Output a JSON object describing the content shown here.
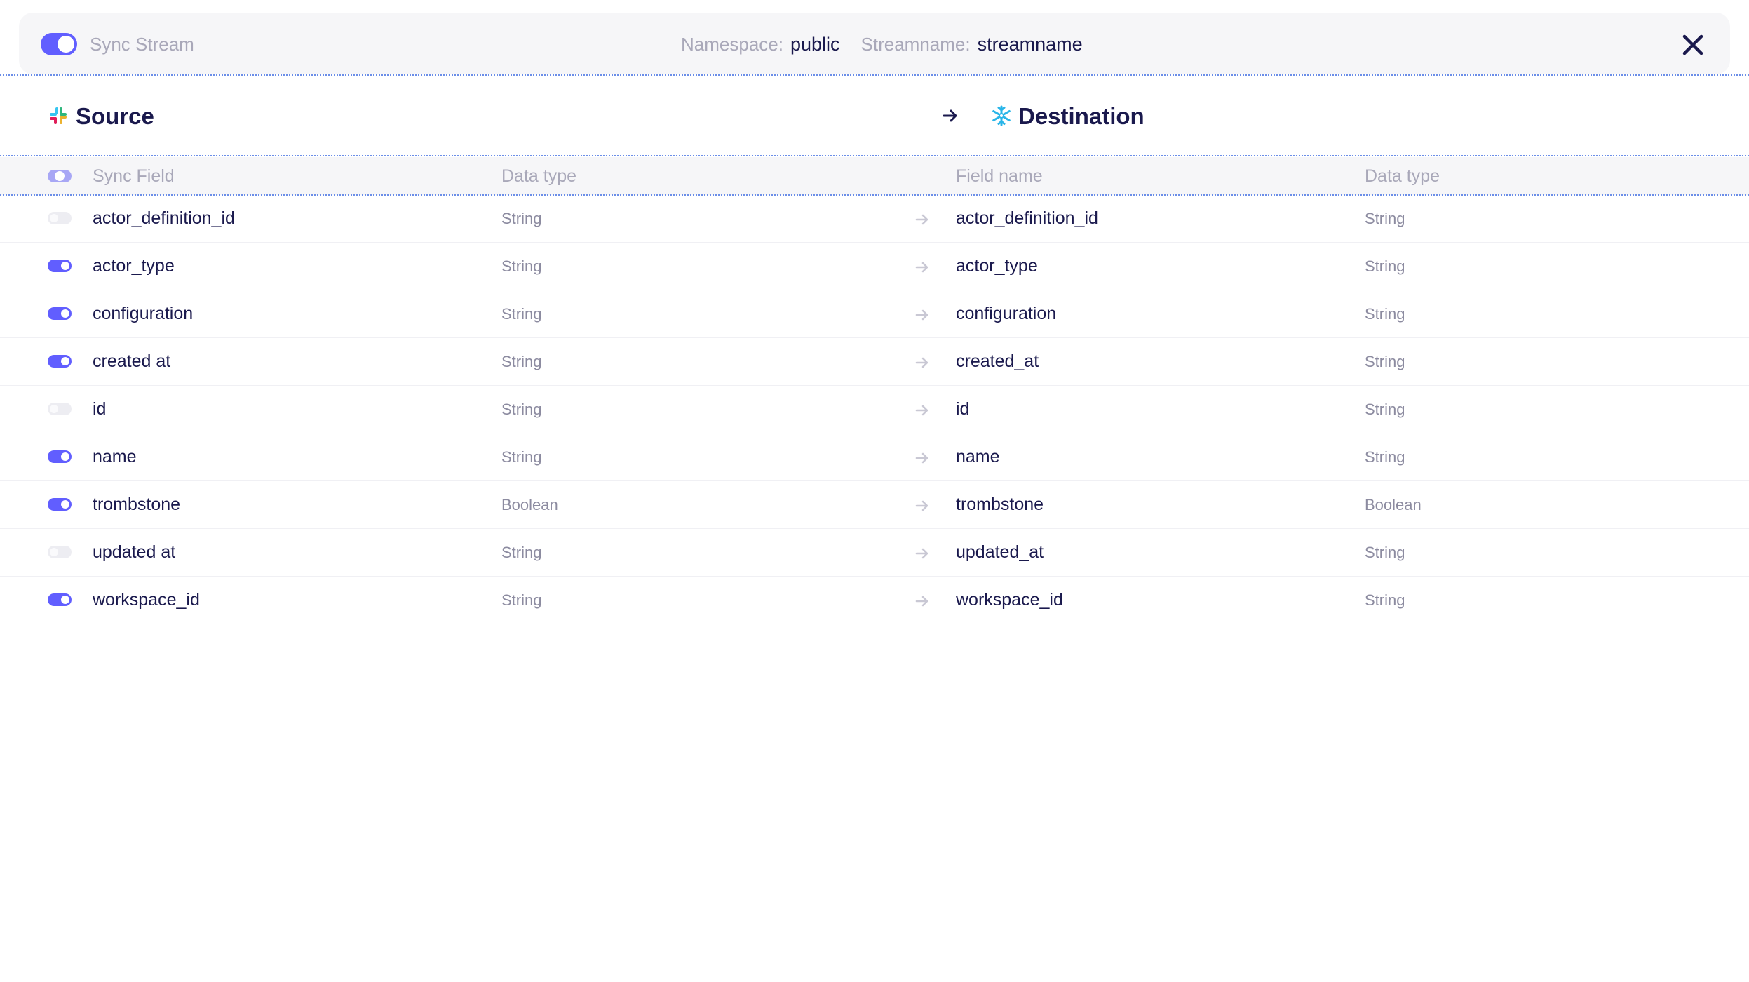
{
  "header": {
    "sync_stream_label": "Sync Stream",
    "sync_stream_enabled": true,
    "namespace_label": "Namespace:",
    "namespace_value": "public",
    "streamname_label": "Streamname:",
    "streamname_value": "streamname",
    "close_icon": "close-icon"
  },
  "source": {
    "title": "Source",
    "icon": "slack-logo-icon"
  },
  "destination": {
    "title": "Destination",
    "icon": "snowflake-icon"
  },
  "columns": {
    "sync_field": "Sync Field",
    "source_data_type": "Data type",
    "field_name": "Field name",
    "destination_data_type": "Data type"
  },
  "colors": {
    "accent": "#615eff",
    "text_primary": "#1a194d",
    "text_muted": "#a9a8b9",
    "divider": "#6b8ee8"
  },
  "rows": [
    {
      "enabled": false,
      "source_field": "actor_definition_id",
      "source_type": "String",
      "dest_field": "actor_definition_id",
      "dest_type": "String"
    },
    {
      "enabled": true,
      "source_field": "actor_type",
      "source_type": "String",
      "dest_field": "actor_type",
      "dest_type": "String"
    },
    {
      "enabled": true,
      "source_field": "configuration",
      "source_type": "String",
      "dest_field": "configuration",
      "dest_type": "String"
    },
    {
      "enabled": true,
      "source_field": "created at",
      "source_type": "String",
      "dest_field": "created_at",
      "dest_type": "String"
    },
    {
      "enabled": false,
      "source_field": "id",
      "source_type": "String",
      "dest_field": "id",
      "dest_type": "String"
    },
    {
      "enabled": true,
      "source_field": "name",
      "source_type": "String",
      "dest_field": "name",
      "dest_type": "String"
    },
    {
      "enabled": true,
      "source_field": "trombstone",
      "source_type": "Boolean",
      "dest_field": "trombstone",
      "dest_type": "Boolean"
    },
    {
      "enabled": false,
      "source_field": "updated at",
      "source_type": "String",
      "dest_field": "updated_at",
      "dest_type": "String"
    },
    {
      "enabled": true,
      "source_field": "workspace_id",
      "source_type": "String",
      "dest_field": "workspace_id",
      "dest_type": "String"
    }
  ]
}
